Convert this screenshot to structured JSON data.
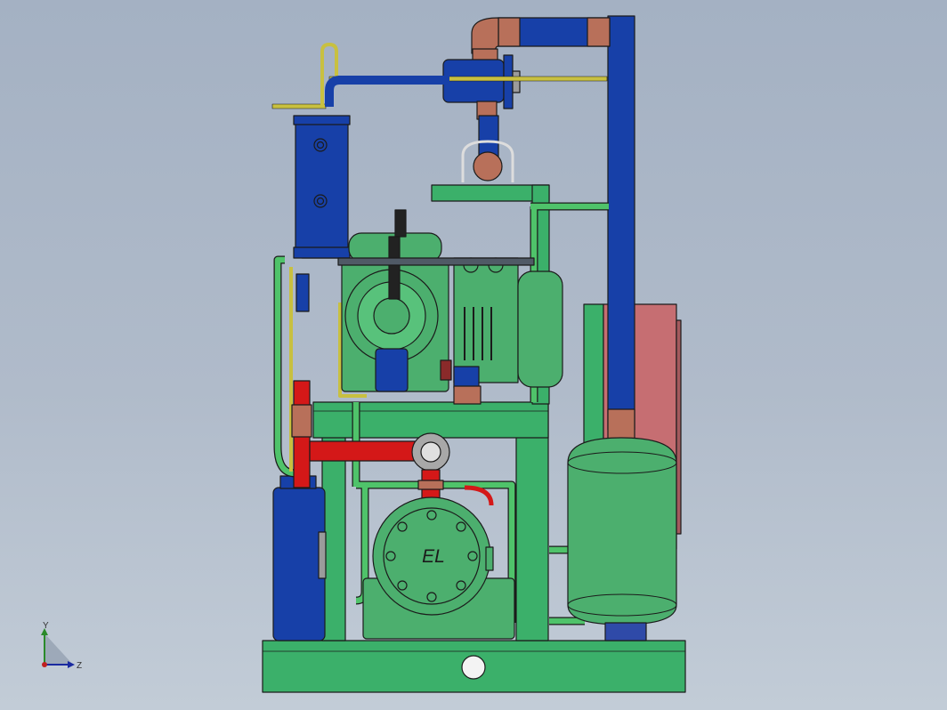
{
  "nameplate": {
    "text": "EL"
  },
  "triad": {
    "y_label": "Y",
    "z_label": "Z"
  },
  "colors": {
    "background_top": "#a4b1c3",
    "background_bottom": "#c2ccd7",
    "frame_green": "#3bb06a",
    "equipment_green": "#4caf6e",
    "pipe_blue": "#1740a8",
    "pipe_red": "#d41818",
    "pipe_yellow": "#c8c040",
    "copper": "#b8705a",
    "panel_red": "#c66e72",
    "outline": "#1b1b1b"
  },
  "icons": {
    "triad": "coordinate-axes-icon",
    "nameplate": "compressor-nameplate"
  }
}
